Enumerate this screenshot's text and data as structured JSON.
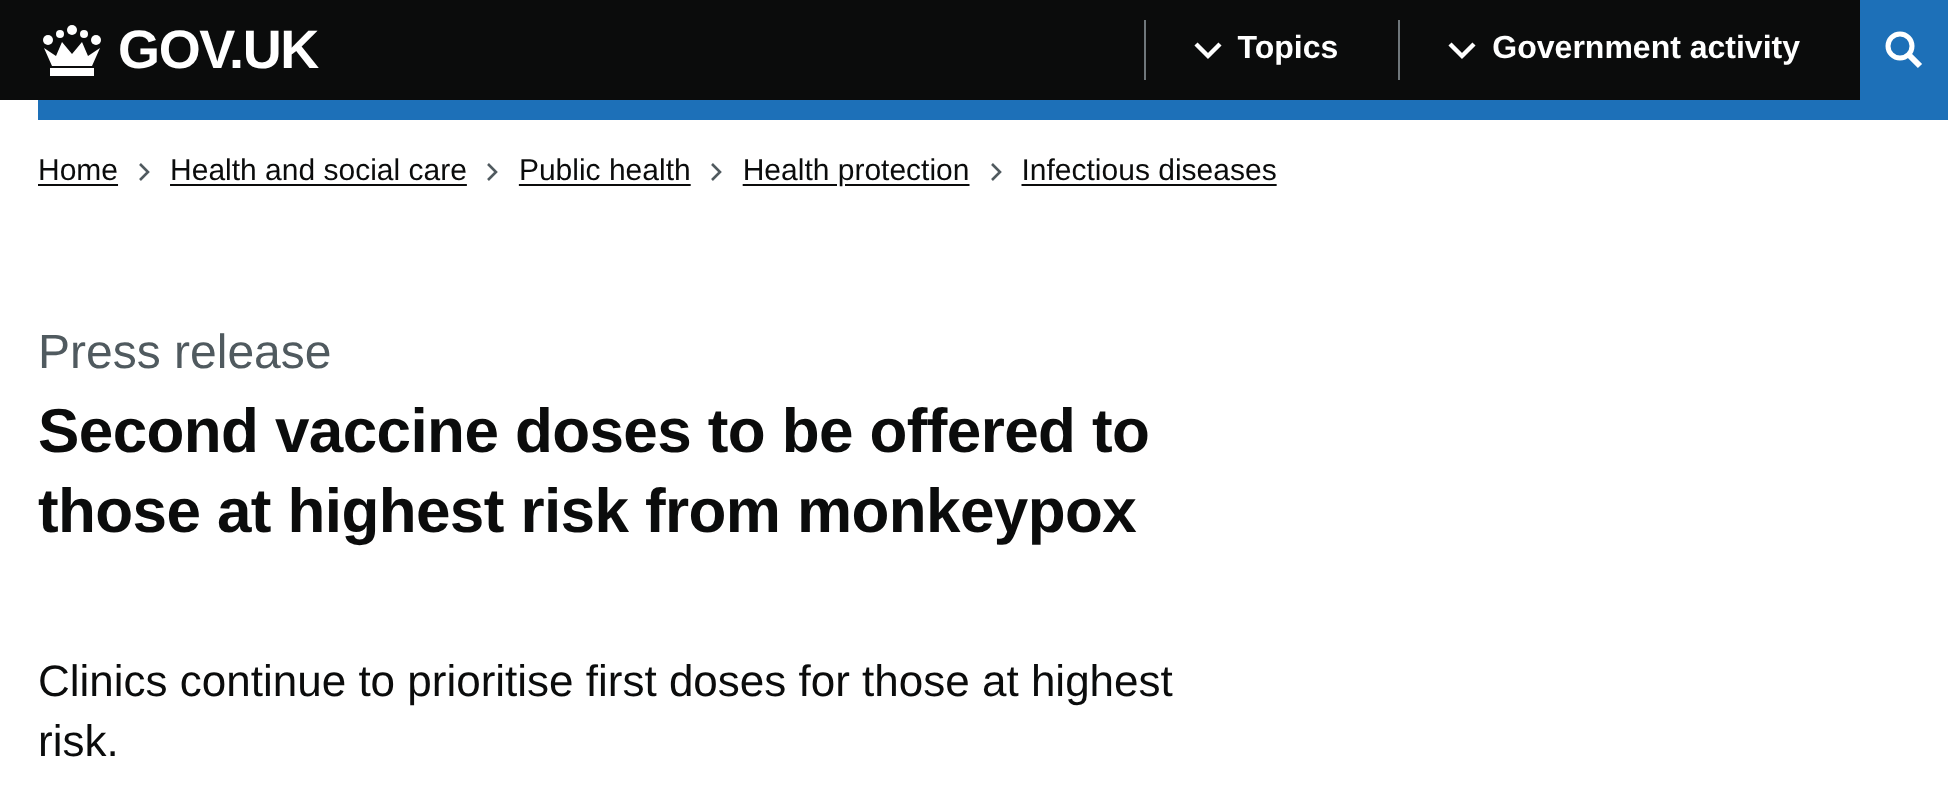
{
  "header": {
    "logo": "GOV.UK",
    "nav": [
      {
        "label": "Topics",
        "expanded": false
      },
      {
        "label": "Government activity",
        "expanded": false
      }
    ]
  },
  "breadcrumbs": [
    "Home",
    "Health and social care",
    "Public health",
    "Health protection",
    "Infectious diseases"
  ],
  "caption": "Press release",
  "title": "Second vaccine doses to be offered to those at highest risk from monkeypox",
  "lead": "Clinics continue to prioritise first doses for those at highest risk."
}
